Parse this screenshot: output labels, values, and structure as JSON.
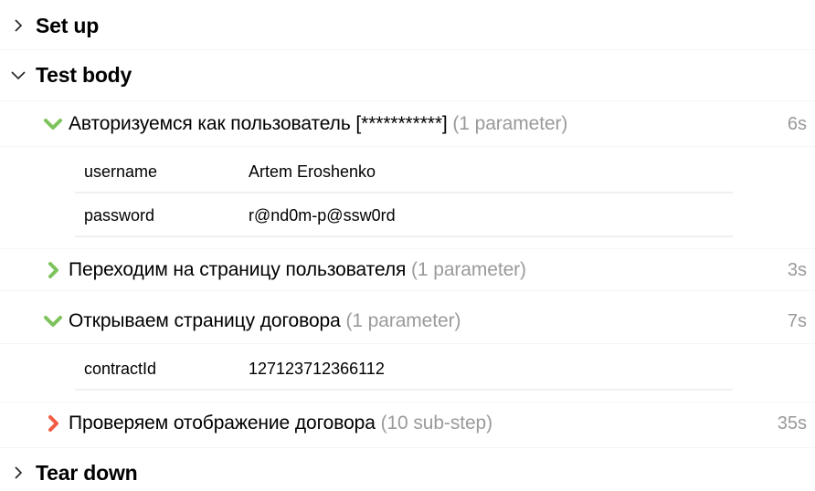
{
  "sections": [
    {
      "title": "Set up",
      "expanded": false,
      "icon": "chevron-right-icon"
    },
    {
      "title": "Test body",
      "expanded": true,
      "icon": "chevron-down-icon"
    },
    {
      "title": "Tear down",
      "expanded": false,
      "icon": "chevron-right-icon"
    }
  ],
  "steps": [
    {
      "name": "Авторизуемся как пользователь [***********]",
      "meta": "(1 parameter)",
      "duration": "6s",
      "status": "passed",
      "expanded": true,
      "params": [
        {
          "name": "username",
          "value": "Artem Eroshenko"
        },
        {
          "name": "password",
          "value": "r@nd0m-p@ssw0rd"
        }
      ]
    },
    {
      "name": "Переходим на страницу пользователя",
      "meta": "(1 parameter)",
      "duration": "3s",
      "status": "passed",
      "expanded": false,
      "params": []
    },
    {
      "name": "Открываем страницу договора",
      "meta": "(1 parameter)",
      "duration": "7s",
      "status": "passed",
      "expanded": true,
      "params": [
        {
          "name": "contractId",
          "value": "127123712366112"
        }
      ]
    },
    {
      "name": "Проверяем отображение договора",
      "meta": "(10 sub-step)",
      "duration": "35s",
      "status": "failed",
      "expanded": false,
      "params": []
    }
  ],
  "colors": {
    "passed": "#7dc35b",
    "failed": "#f25c43",
    "muted": "#999999"
  }
}
